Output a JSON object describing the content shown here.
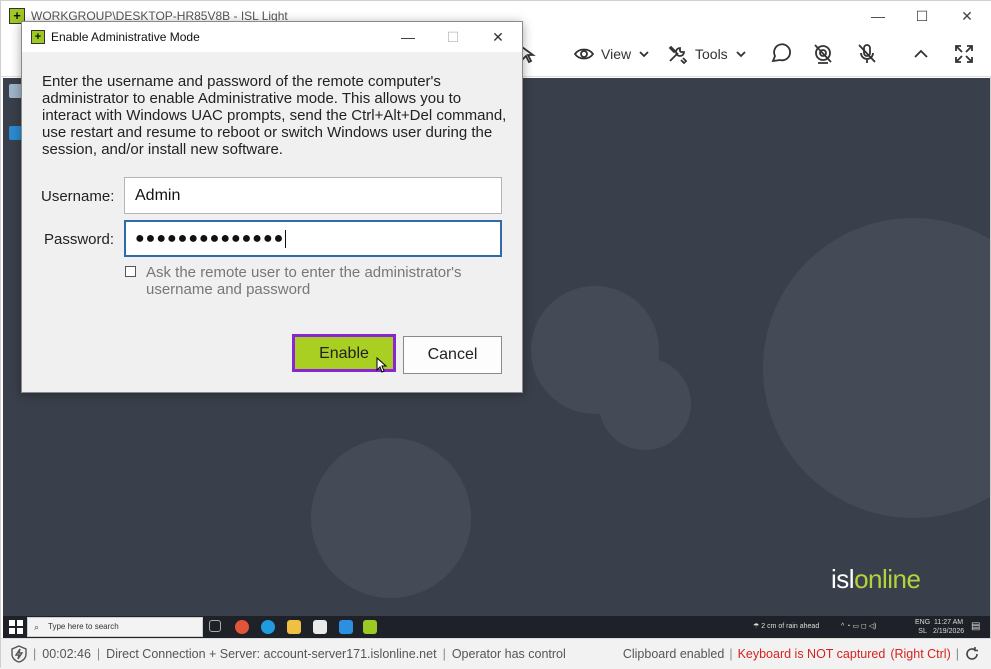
{
  "window": {
    "title": "WORKGROUP\\DESKTOP-HR85V8B - ISL Light",
    "icon": "isl-light-plus-icon",
    "controls": {
      "minimize": "—",
      "maximize": "☐",
      "close": "✕"
    }
  },
  "toolbar": {
    "view_label": "View",
    "tools_label": "Tools"
  },
  "dialog": {
    "title": "Enable Administrative Mode",
    "description": "Enter the username and password of the remote computer's administrator to enable Administrative mode. This allows you to interact with Windows UAC prompts, send the Ctrl+Alt+Del command, use restart and resume to reboot or switch Windows user during the session, and/or install new software.",
    "username_label": "Username:",
    "username_value": "Admin",
    "password_label": "Password:",
    "password_value": "●●●●●●●●●●●●●●",
    "checkbox_label": "Ask the remote user to enter the administrator's username and password",
    "checkbox_checked": false,
    "enable_label": "Enable",
    "cancel_label": "Cancel",
    "controls": {
      "minimize": "—",
      "maximize": "☐",
      "close": "✕"
    }
  },
  "remote_desktop": {
    "brand_prefix": "isl",
    "brand_suffix": "online",
    "taskbar": {
      "search_placeholder": "Type here to search",
      "weather": "2 cm of rain ahead",
      "language_top": "ENG",
      "language_bottom": "SL",
      "time": "11:27 AM",
      "date": "2/19/2026"
    }
  },
  "status": {
    "timer": "00:02:46",
    "connection": "Direct Connection + Server: account-server171.islonline.net",
    "control": "Operator has control",
    "clipboard": "Clipboard enabled",
    "keyboard": "Keyboard is NOT captured",
    "keyboard_hint": "(Right Ctrl)"
  },
  "colors": {
    "accent_green": "#a8cf22",
    "focus_purple": "#8a24d4",
    "desktop_bg": "#3a404b",
    "warning_red": "#d6231f"
  }
}
